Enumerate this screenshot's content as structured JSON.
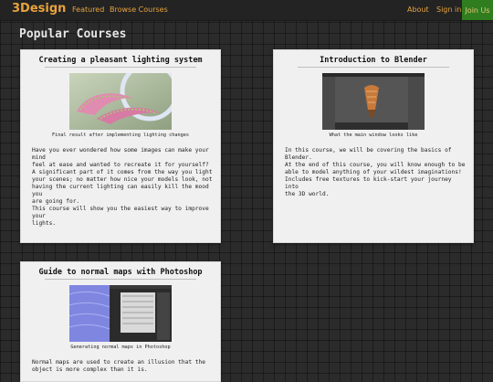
{
  "nav": {
    "brand": "3Design",
    "links": [
      "Featured",
      "Browse Courses"
    ],
    "about": "About",
    "signin": "Sign in",
    "join": "Join Us"
  },
  "page_title": "Popular Courses",
  "courses": [
    {
      "title": "Creating a pleasant lighting system",
      "caption": "Final result after implementing lighting changes",
      "description": "Have you ever wondered how some images can make your mind\nfeel at ease and wanted to recreate it for yourself?\nA significant part of it comes from the way you light\nyour scenes; no matter how nice your models look, not\nhaving the current lighting can easily kill the mood you\nare going for.\nThis course will show you the easiest way to improve your\nlights."
    },
    {
      "title": "Introduction to Blender",
      "caption": "What the main window looks like",
      "description": "In this course, we will be covering the basics of\nBlender.\nAt the end of this course, you will know enough to be\nable to model anything of your wildest imaginations!\nIncludes free textures to kick-start your journey into\nthe 3D world."
    },
    {
      "title": "Guide to normal maps with Photoshop",
      "caption": "Generating normal maps in Photoshop",
      "description": "Normal maps are used to create an illusion that the\nobject is more complex than it is."
    }
  ],
  "colors": {
    "accent": "#e8a33c",
    "join_bg": "#2f7d1f",
    "card_bg": "#f0f0f0",
    "page_bg": "#2b2b2b"
  }
}
